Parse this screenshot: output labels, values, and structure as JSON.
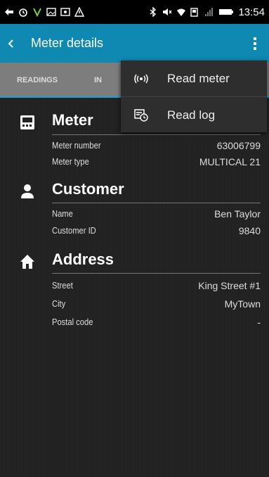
{
  "status_bar": {
    "time": "13:54",
    "icons": [
      "back-arrow-icon",
      "alarm-icon",
      "vpn-icon",
      "image-icon",
      "photo-icon",
      "alert-icon",
      "bluetooth-icon",
      "mute-icon",
      "wifi-icon",
      "screen-icon",
      "signal-icon",
      "battery-icon"
    ]
  },
  "app_bar": {
    "title": "Meter details",
    "color": "#0f88b2"
  },
  "tabs": {
    "readings": "READINGS",
    "second_partial": "IN"
  },
  "menu": {
    "items": [
      {
        "label": "Read meter",
        "icon": "radio-waves-icon"
      },
      {
        "label": "Read log",
        "icon": "log-clock-icon"
      }
    ]
  },
  "meter": {
    "title": "Meter",
    "rows": [
      {
        "label": "Meter number",
        "value": "63006799"
      },
      {
        "label": "Meter type",
        "value": "MULTICAL 21"
      }
    ]
  },
  "customer": {
    "title": "Customer",
    "rows": [
      {
        "label": "Name",
        "value": "Ben Taylor"
      },
      {
        "label": "Customer ID",
        "value": "9840"
      }
    ]
  },
  "address": {
    "title": "Address",
    "rows": [
      {
        "label": "Street",
        "value": "King Street #1"
      },
      {
        "label": "City",
        "value": "MyTown"
      },
      {
        "label": "Postal code",
        "value": "-"
      }
    ]
  }
}
